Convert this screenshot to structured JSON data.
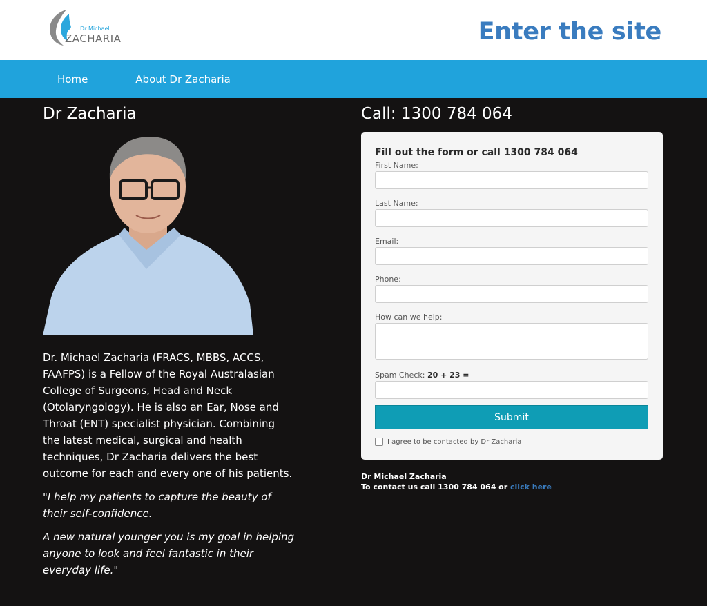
{
  "header": {
    "logo_small": "Dr Michael",
    "logo_big": "ZACHARIA",
    "enter_link": "Enter the site"
  },
  "nav": {
    "items": [
      {
        "label": "Home"
      },
      {
        "label": "About Dr Zacharia"
      }
    ]
  },
  "left": {
    "heading": "Dr Zacharia",
    "bio": "Dr. Michael Zacharia (FRACS, MBBS, ACCS, FAAFPS) is a Fellow of the Royal Australasian College of Surgeons, Head and Neck (Otolaryngology). He is also an Ear, Nose and Throat (ENT) specialist physician. Combining the latest medical, surgical and health techniques, Dr Zacharia delivers the best outcome for each and every one of his patients.",
    "quote_open": "\"",
    "quote1": "I help my patients to capture the beauty of their self-confidence.",
    "quote2": "A new natural younger you is my goal in helping anyone to look and feel fantastic in their everyday life.",
    "quote_close": "\""
  },
  "right": {
    "heading": "Call: 1300 784 064",
    "form": {
      "title": "Fill out the form or call 1300 784 064",
      "first_name_label": "First Name:",
      "last_name_label": "Last Name:",
      "email_label": "Email:",
      "phone_label": "Phone:",
      "help_label": "How can we help:",
      "spam_label": "Spam Check:",
      "spam_question": "20 + 23 =",
      "submit_label": "Submit",
      "agree_label": "I agree to be contacted by Dr Zacharia"
    },
    "contact": {
      "name": "Dr Michael Zacharia",
      "line_prefix": "To contact us call 1300 784 064 or",
      "link": "click here"
    }
  },
  "colors": {
    "nav": "#20a3dc",
    "background": "#141212",
    "accent_link": "#3a7cbf",
    "submit": "#0f9db5"
  }
}
